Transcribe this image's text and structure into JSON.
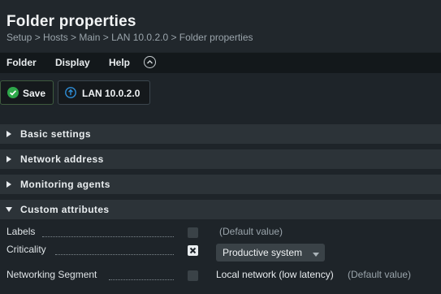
{
  "header": {
    "title": "Folder properties",
    "breadcrumb": "Setup > Hosts > Main > LAN 10.0.2.0 > Folder properties"
  },
  "menu": {
    "items": [
      "Folder",
      "Display",
      "Help"
    ],
    "toggle_icon": "chevron-up-icon"
  },
  "toolbar": {
    "save_label": "Save",
    "save_icon": "check-circle-icon",
    "lan_label": "LAN 10.0.2.0",
    "lan_icon": "up-arrow-circle-icon"
  },
  "sections": [
    {
      "label": "Basic settings",
      "expanded": false
    },
    {
      "label": "Network address",
      "expanded": false
    },
    {
      "label": "Monitoring agents",
      "expanded": false
    },
    {
      "label": "Custom attributes",
      "expanded": true
    }
  ],
  "custom_attributes": {
    "labels": {
      "label": "Labels",
      "checked": false,
      "default_text": "(Default value)"
    },
    "criticality": {
      "label": "Criticality",
      "checked": true,
      "value": "Productive system"
    },
    "networking_segment": {
      "label": "Networking Segment",
      "checked": false,
      "value": "Local network (low latency)",
      "default_text": "(Default value)"
    }
  },
  "colors": {
    "background": "#1e2429",
    "section_bar": "#2c3338",
    "success": "#2ea84a",
    "info": "#2f8fd8"
  }
}
